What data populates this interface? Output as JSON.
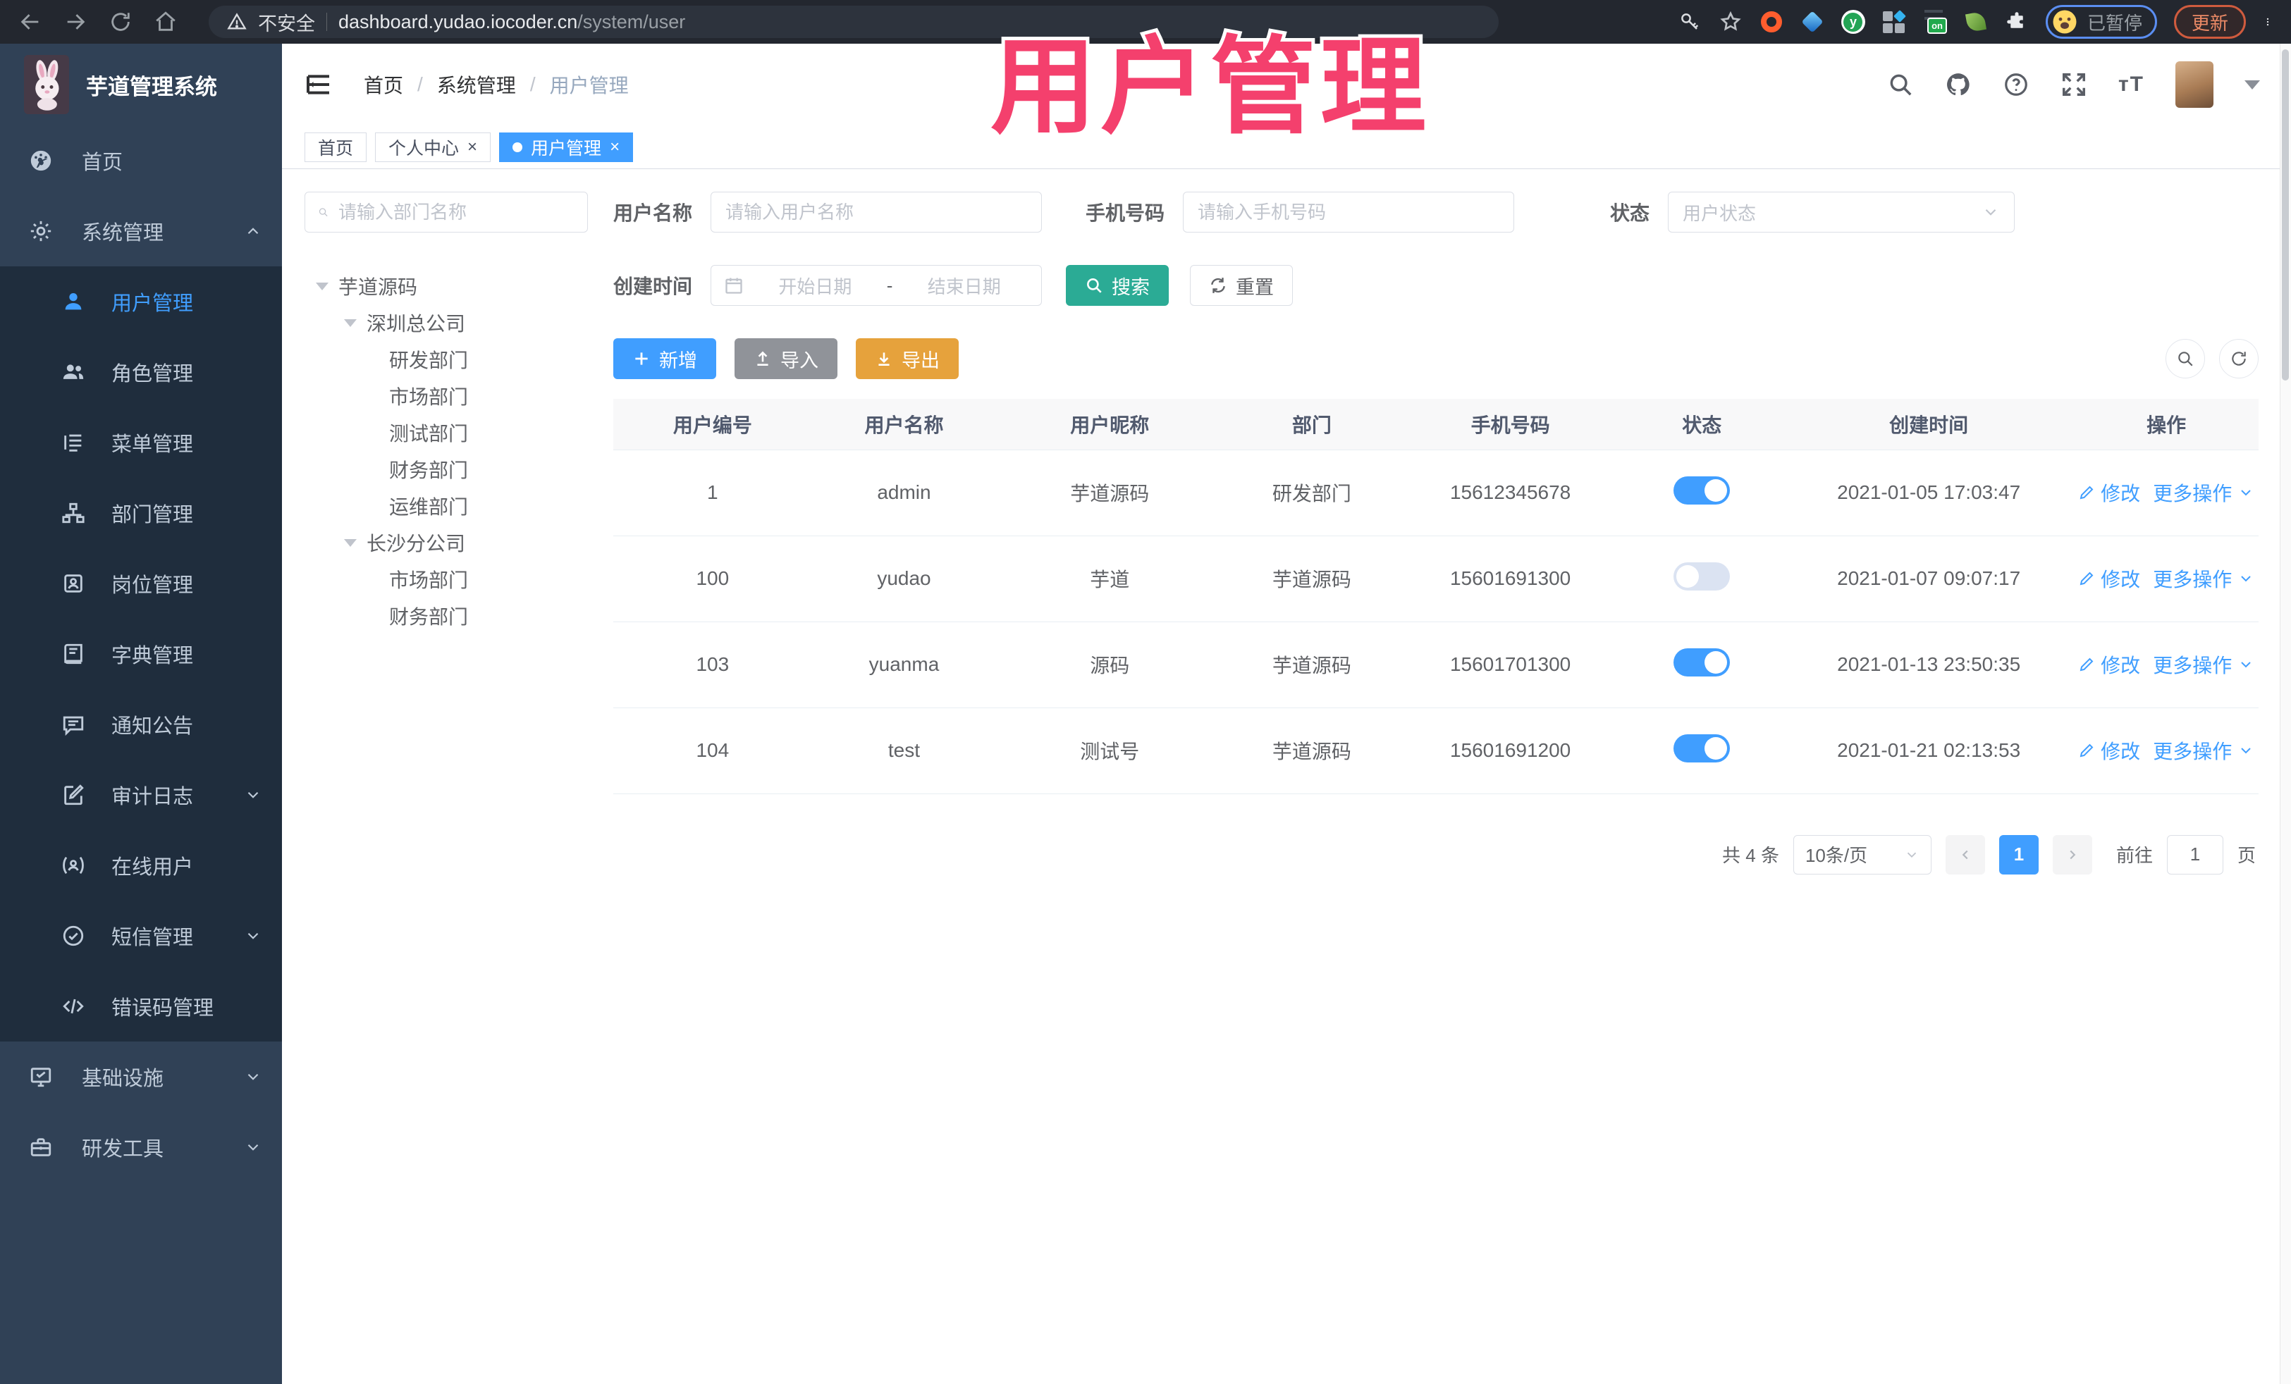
{
  "browser": {
    "security_label": "不安全",
    "url_host": "dashboard.yudao.iocoder.cn",
    "url_path": "/system/user",
    "paused_badge": "已暂停",
    "update_button": "更新"
  },
  "watermark": "用户管理",
  "colors": {
    "accent": "#409eff",
    "sidebar_bg": "#304156",
    "submenu_bg": "#1f2d3d",
    "search_button": "#2bab95",
    "import_button": "#909399",
    "export_button": "#e6a23c",
    "watermark_pink": "#f4406d",
    "toggle_on": "#409eff"
  },
  "app": {
    "title": "芋道管理系统"
  },
  "breadcrumb": {
    "items": [
      "首页",
      "系统管理",
      "用户管理"
    ],
    "separator": "/"
  },
  "tabs": [
    {
      "label": "首页"
    },
    {
      "label": "个人中心"
    },
    {
      "label": "用户管理"
    }
  ],
  "sidebar": {
    "home": "首页",
    "system": "系统管理",
    "system_children": [
      "用户管理",
      "角色管理",
      "菜单管理",
      "部门管理",
      "岗位管理",
      "字典管理",
      "通知公告",
      "审计日志",
      "在线用户",
      "短信管理",
      "错误码管理"
    ],
    "infra": "基础设施",
    "devtools": "研发工具"
  },
  "dept_panel": {
    "search_placeholder": "请输入部门名称",
    "tree": [
      "芋道源码",
      "深圳总公司",
      "研发部门",
      "市场部门",
      "测试部门",
      "财务部门",
      "运维部门",
      "长沙分公司",
      "市场部门",
      "财务部门"
    ]
  },
  "filters": {
    "username_label": "用户名称",
    "username_placeholder": "请输入用户名称",
    "mobile_label": "手机号码",
    "mobile_placeholder": "请输入手机号码",
    "status_label": "状态",
    "status_placeholder": "用户状态",
    "create_time_label": "创建时间",
    "date_start_placeholder": "开始日期",
    "date_separator": "-",
    "date_end_placeholder": "结束日期",
    "search_button": "搜索",
    "reset_button": "重置"
  },
  "toolbar": {
    "add": "新增",
    "import": "导入",
    "export": "导出"
  },
  "table": {
    "columns": [
      "用户编号",
      "用户名称",
      "用户昵称",
      "部门",
      "手机号码",
      "状态",
      "创建时间",
      "操作"
    ],
    "row_actions": {
      "edit": "修改",
      "more": "更多操作"
    },
    "rows": [
      {
        "id": "1",
        "username": "admin",
        "nickname": "芋道源码",
        "dept": "研发部门",
        "mobile": "15612345678",
        "status": "on",
        "created": "2021-01-05 17:03:47"
      },
      {
        "id": "100",
        "username": "yudao",
        "nickname": "芋道",
        "dept": "芋道源码",
        "mobile": "15601691300",
        "status": "off",
        "created": "2021-01-07 09:07:17"
      },
      {
        "id": "103",
        "username": "yuanma",
        "nickname": "源码",
        "dept": "芋道源码",
        "mobile": "15601701300",
        "status": "on",
        "created": "2021-01-13 23:50:35"
      },
      {
        "id": "104",
        "username": "test",
        "nickname": "测试号",
        "dept": "芋道源码",
        "mobile": "15601691200",
        "status": "on",
        "created": "2021-01-21 02:13:53"
      }
    ]
  },
  "pagination": {
    "total": "共 4 条",
    "page_size": "10条/页",
    "current_page": "1",
    "goto_label": "前往",
    "goto_value": "1",
    "page_unit": "页"
  }
}
